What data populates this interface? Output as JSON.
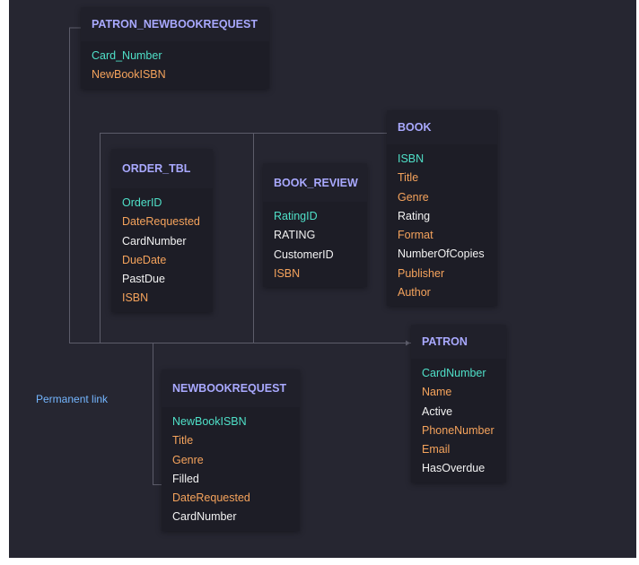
{
  "entities": {
    "patron_newbookrequest": {
      "name": "PATRON_NEWBOOKREQUEST",
      "fields": [
        {
          "name": "Card_Number",
          "kind": "pk"
        },
        {
          "name": "NewBookISBN",
          "kind": "fk"
        }
      ]
    },
    "book": {
      "name": "BOOK",
      "fields": [
        {
          "name": "ISBN",
          "kind": "pk"
        },
        {
          "name": "Title",
          "kind": "fk"
        },
        {
          "name": "Genre",
          "kind": "fk"
        },
        {
          "name": "Rating",
          "kind": "col"
        },
        {
          "name": "Format",
          "kind": "fk"
        },
        {
          "name": "NumberOfCopies",
          "kind": "col"
        },
        {
          "name": "Publisher",
          "kind": "fk"
        },
        {
          "name": "Author",
          "kind": "fk"
        }
      ]
    },
    "order_tbl": {
      "name": "ORDER_TBL",
      "fields": [
        {
          "name": "OrderID",
          "kind": "pk"
        },
        {
          "name": "DateRequested",
          "kind": "fk"
        },
        {
          "name": "CardNumber",
          "kind": "col"
        },
        {
          "name": "DueDate",
          "kind": "fk"
        },
        {
          "name": "PastDue",
          "kind": "col"
        },
        {
          "name": "ISBN",
          "kind": "fk"
        }
      ]
    },
    "book_review": {
      "name": "BOOK_REVIEW",
      "fields": [
        {
          "name": "RatingID",
          "kind": "pk"
        },
        {
          "name": "RATING",
          "kind": "col"
        },
        {
          "name": "CustomerID",
          "kind": "col"
        },
        {
          "name": "ISBN",
          "kind": "fk"
        }
      ]
    },
    "patron": {
      "name": "PATRON",
      "fields": [
        {
          "name": "CardNumber",
          "kind": "pk"
        },
        {
          "name": "Name",
          "kind": "fk"
        },
        {
          "name": "Active",
          "kind": "col"
        },
        {
          "name": "PhoneNumber",
          "kind": "fk"
        },
        {
          "name": "Email",
          "kind": "fk"
        },
        {
          "name": "HasOverdue",
          "kind": "col"
        }
      ]
    },
    "newbookrequest": {
      "name": "NEWBOOKREQUEST",
      "fields": [
        {
          "name": "NewBookISBN",
          "kind": "pk"
        },
        {
          "name": "Title",
          "kind": "fk"
        },
        {
          "name": "Genre",
          "kind": "fk"
        },
        {
          "name": "Filled",
          "kind": "col"
        },
        {
          "name": "DateRequested",
          "kind": "fk"
        },
        {
          "name": "CardNumber",
          "kind": "col"
        }
      ]
    }
  },
  "permanent_link": "Permanent link",
  "colors": {
    "background": "#262631",
    "header_text": "#a9a9ff",
    "primary_key": "#4fe0c8",
    "foreign_key": "#f5a35c",
    "column": "#f2f2f2",
    "link": "#74b6ff",
    "connector": "#5c5c6a"
  }
}
